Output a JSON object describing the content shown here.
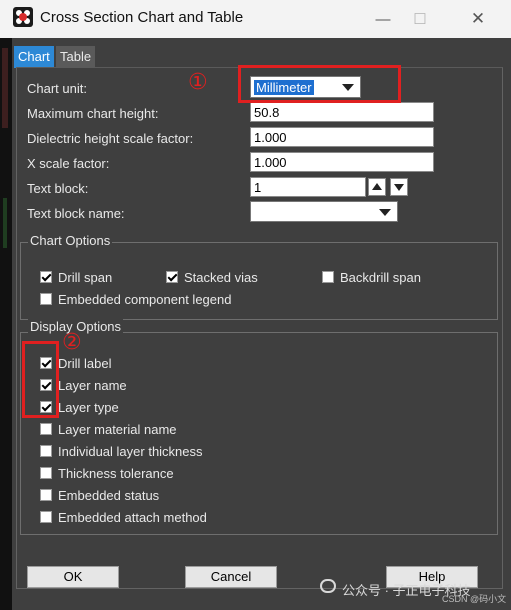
{
  "window": {
    "title": "Cross Section Chart and Table",
    "controls": {
      "minimize": "—",
      "maximize": "☐",
      "close": "✕"
    }
  },
  "tabs": [
    {
      "label": "Chart",
      "active": true
    },
    {
      "label": "Table",
      "active": false
    }
  ],
  "form": {
    "chart_unit_label": "Chart unit:",
    "chart_unit_value": "Millimeter",
    "max_height_label": "Maximum chart height:",
    "max_height_value": "50.8",
    "dielectric_label": "Dielectric height scale factor:",
    "dielectric_value": "1.000",
    "x_scale_label": "X scale factor:",
    "x_scale_value": "1.000",
    "text_block_label": "Text block:",
    "text_block_value": "1",
    "text_block_name_label": "Text block name:",
    "text_block_name_value": ""
  },
  "chart_options": {
    "title": "Chart Options",
    "items": [
      {
        "label": "Drill span",
        "checked": true
      },
      {
        "label": "Stacked vias",
        "checked": true
      },
      {
        "label": "Backdrill span",
        "checked": false
      },
      {
        "label": "Embedded component legend",
        "checked": false
      }
    ]
  },
  "display_options": {
    "title": "Display Options",
    "items": [
      {
        "label": "Drill label",
        "checked": true
      },
      {
        "label": "Layer name",
        "checked": true
      },
      {
        "label": "Layer type",
        "checked": true
      },
      {
        "label": "Layer material name",
        "checked": false
      },
      {
        "label": "Individual layer thickness",
        "checked": false
      },
      {
        "label": "Thickness tolerance",
        "checked": false
      },
      {
        "label": "Embedded status",
        "checked": false
      },
      {
        "label": "Embedded attach method",
        "checked": false
      }
    ]
  },
  "buttons": {
    "ok": "OK",
    "cancel": "Cancel",
    "help": "Help"
  },
  "annotations": {
    "one": "①",
    "two": "②"
  },
  "watermark": {
    "text": "公众号 · 子正电子科技",
    "credit": "CSDN @码小文"
  },
  "colors": {
    "accent": "#2d89d6",
    "annotation": "#e02020",
    "dialog_bg": "#3f3f3f"
  }
}
